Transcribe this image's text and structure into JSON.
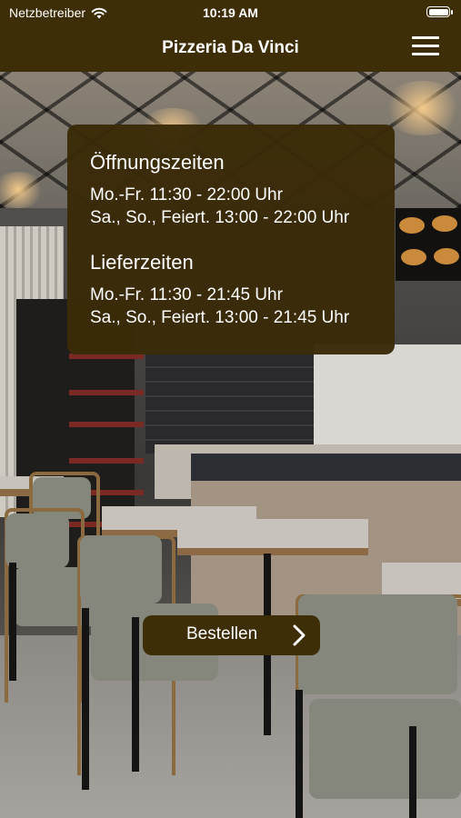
{
  "status_bar": {
    "carrier": "Netzbetreiber",
    "time": "10:19 AM"
  },
  "nav": {
    "title": "Pizzeria Da Vinci",
    "menu_icon": "hamburger-menu-icon"
  },
  "hours_card": {
    "opening_title": "Öffnungszeiten",
    "opening_lines": [
      "Mo.-Fr. 11:30 - 22:00 Uhr",
      "Sa., So., Feiert. 13:00 - 22:00 Uhr"
    ],
    "delivery_title": "Lieferzeiten",
    "delivery_lines": [
      "Mo.-Fr. 11:30 - 21:45 Uhr",
      "Sa., So., Feiert. 13:00 - 21:45 Uhr"
    ]
  },
  "order_button": {
    "label": "Bestellen",
    "icon": "chevron-right-icon"
  },
  "colors": {
    "brand_brown": "#3e2e08",
    "text": "#ffffff"
  }
}
